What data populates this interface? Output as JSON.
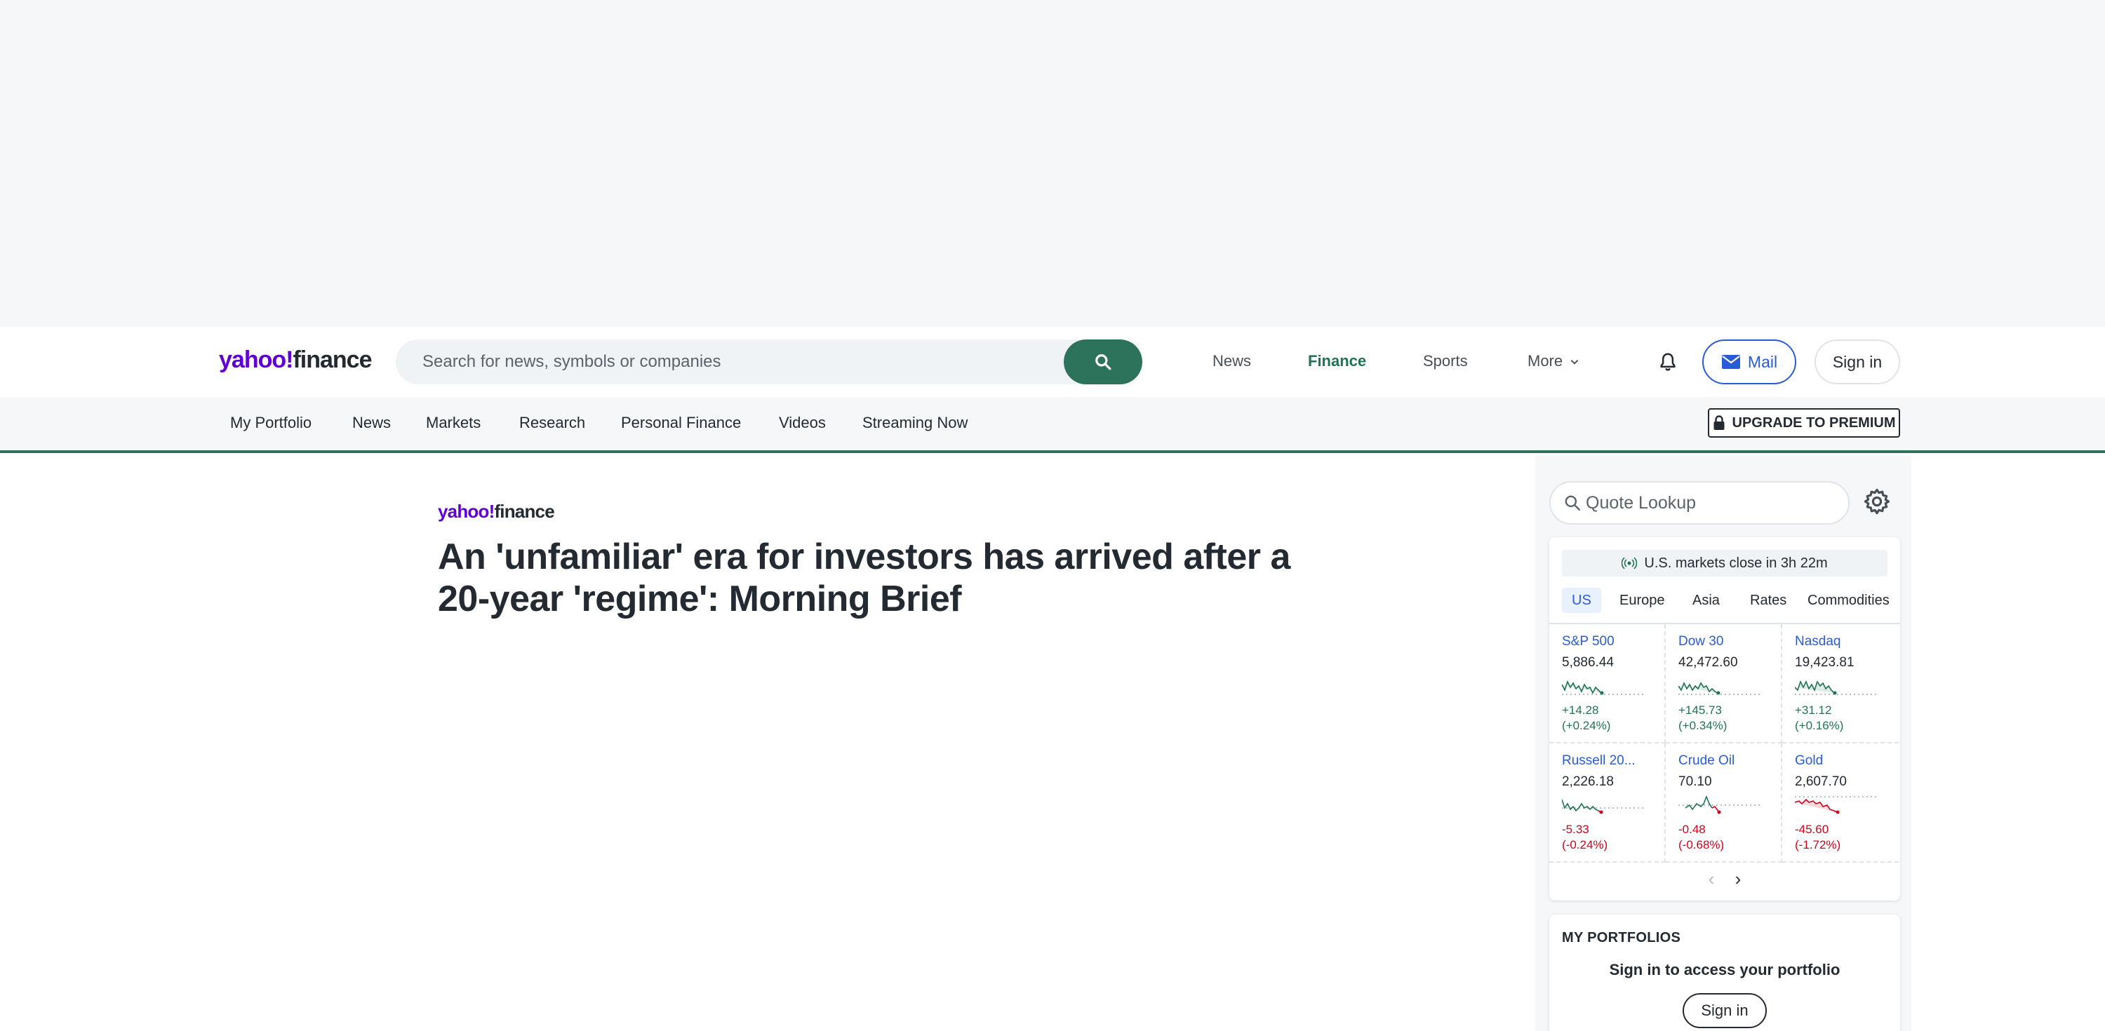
{
  "brand": {
    "logo_yahoo": "yahoo",
    "logo_bang": "!",
    "logo_finance": "finance",
    "accent": "#2d735c",
    "purple": "#6001d2"
  },
  "search": {
    "placeholder": "Search for news, symbols or companies"
  },
  "top_nav": [
    {
      "label": "News",
      "active": false
    },
    {
      "label": "Finance",
      "active": true
    },
    {
      "label": "Sports",
      "active": false
    },
    {
      "label": "More",
      "active": false
    }
  ],
  "header_actions": {
    "mail_label": "Mail",
    "signin_label": "Sign in"
  },
  "subnav": {
    "links": [
      "My Portfolio",
      "News",
      "Markets",
      "Research",
      "Personal Finance",
      "Videos",
      "Streaming Now"
    ],
    "premium_label": "UPGRADE TO PREMIUM"
  },
  "article": {
    "title": "An 'unfamiliar' era for investors has arrived after a 20-year 'regime': Morning Brief"
  },
  "sidebar": {
    "quote_placeholder": "Quote Lookup",
    "market_status": "U.S. markets close in 3h 22m",
    "tabs": [
      {
        "label": "US",
        "active": true
      },
      {
        "label": "Europe",
        "active": false
      },
      {
        "label": "Asia",
        "active": false
      },
      {
        "label": "Rates",
        "active": false
      },
      {
        "label": "Commodities",
        "active": false
      }
    ],
    "markets": [
      {
        "name": "S&P 500",
        "price": "5,886.44",
        "change": "+14.28",
        "pct": "(+0.24%)",
        "direction": "up"
      },
      {
        "name": "Dow 30",
        "price": "42,472.60",
        "change": "+145.73",
        "pct": "(+0.34%)",
        "direction": "up"
      },
      {
        "name": "Nasdaq",
        "price": "19,423.81",
        "change": "+31.12",
        "pct": "(+0.16%)",
        "direction": "up"
      },
      {
        "name": "Russell 20...",
        "price": "2,226.18",
        "change": "-5.33",
        "pct": "(-0.24%)",
        "direction": "down"
      },
      {
        "name": "Crude Oil",
        "price": "70.10",
        "change": "-0.48",
        "pct": "(-0.68%)",
        "direction": "down"
      },
      {
        "name": "Gold",
        "price": "2,607.70",
        "change": "-45.60",
        "pct": "(-1.72%)",
        "direction": "down"
      }
    ],
    "portfolio": {
      "title": "MY PORTFOLIOS",
      "subtitle": "Sign in to access your portfolio",
      "signin_label": "Sign in"
    }
  },
  "colors": {
    "up": "#1f7353",
    "down": "#d0021b",
    "link": "#2a5bd7"
  }
}
